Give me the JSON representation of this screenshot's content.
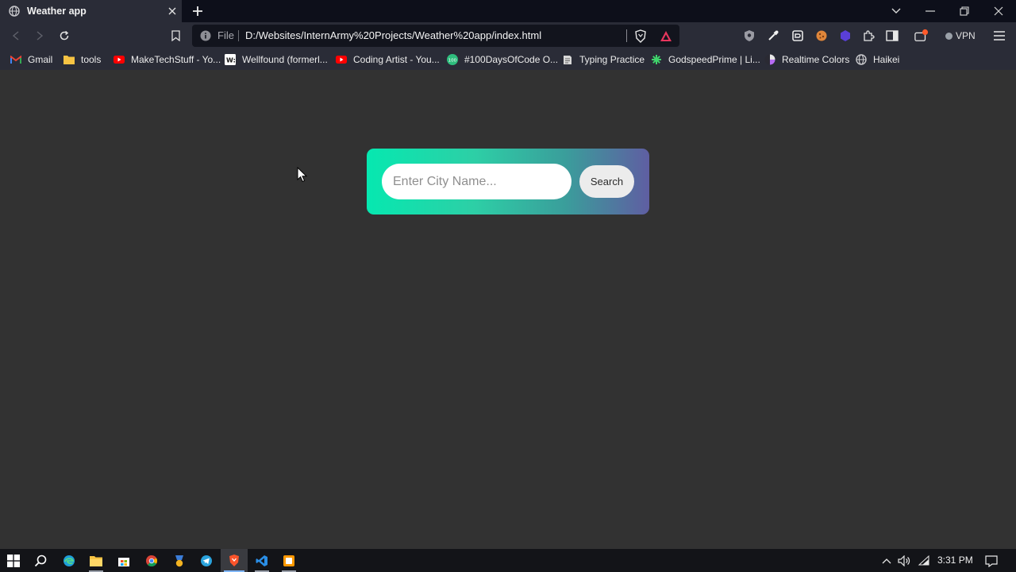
{
  "browser": {
    "tab": {
      "title": "Weather app",
      "favicon": "globe-icon"
    },
    "address_bar": {
      "scheme_label": "File",
      "url": "D:/Websites/InternArmy%20Projects/Weather%20app/index.html"
    },
    "vpn_label": "VPN",
    "bookmarks": [
      {
        "label": "Gmail",
        "icon": "gmail-icon"
      },
      {
        "label": "tools",
        "icon": "folder-icon"
      },
      {
        "label": "MakeTechStuff - Yo...",
        "icon": "youtube-icon"
      },
      {
        "label": "Wellfound (formerl...",
        "icon": "wellfound-icon"
      },
      {
        "label": "Coding Artist - You...",
        "icon": "youtube-icon"
      },
      {
        "label": "#100DaysOfCode O...",
        "icon": "100days-icon"
      },
      {
        "label": "Typing Practice",
        "icon": "typing-icon"
      },
      {
        "label": "GodspeedPrime | Li...",
        "icon": "asterisk-icon"
      },
      {
        "label": "Realtime Colors",
        "icon": "colors-icon"
      },
      {
        "label": "Haikei",
        "icon": "globe-icon"
      }
    ]
  },
  "app": {
    "search": {
      "placeholder": "Enter City Name...",
      "value": "",
      "button_label": "Search"
    },
    "colors": {
      "gradient_start": "#06e8b0",
      "gradient_end": "#5f5ea2",
      "page_bg": "#323232"
    }
  },
  "taskbar": {
    "apps": [
      "start-icon",
      "search-icon",
      "edge-icon",
      "file-explorer-icon",
      "store-icon",
      "chrome-icon",
      "app-icon",
      "telegram-icon",
      "brave-icon",
      "vscode-icon",
      "sublime-icon"
    ],
    "clock": "3:31 PM"
  }
}
